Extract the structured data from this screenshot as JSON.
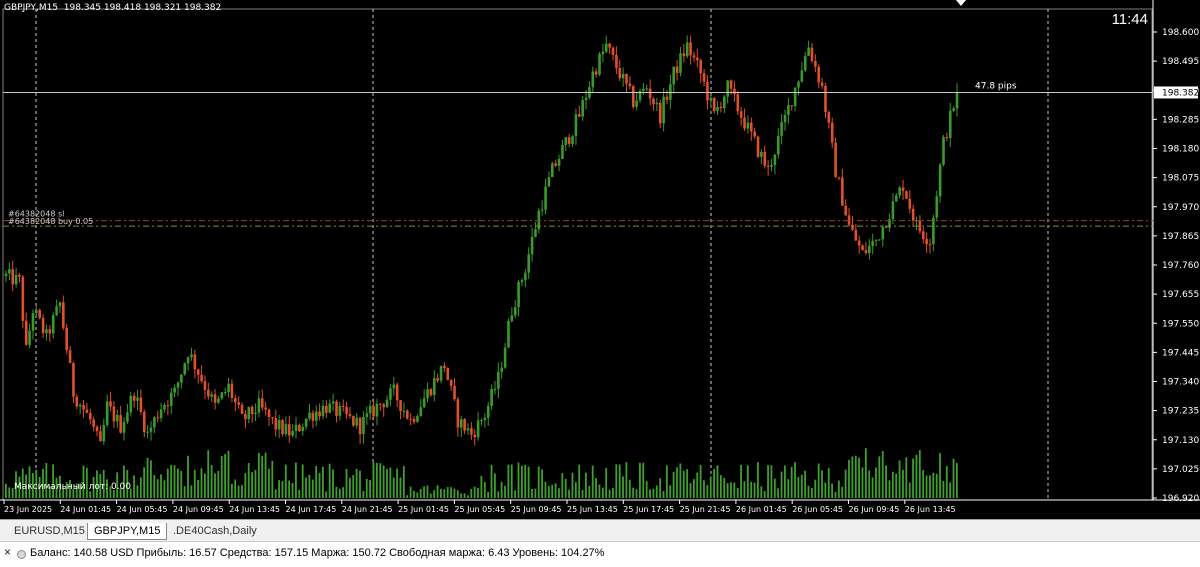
{
  "chart": {
    "title_symbol": "GBPJPY,M15",
    "title_ohlc": "198.345 198.418 198.321 198.382",
    "clock": "11:44",
    "current_price_label": "198.382",
    "pips_label": "47.8 pips",
    "order_label_1": "#64382048 sl",
    "order_label_2": "#64382048 buy 0.05",
    "max_lot_label": "Максимальный лот: 0.00",
    "price_axis": [
      "198.600",
      "198.495",
      "198.390",
      "198.285",
      "198.180",
      "198.075",
      "197.970",
      "197.865",
      "197.760",
      "197.655",
      "197.550",
      "197.445",
      "197.340",
      "197.235",
      "197.130",
      "197.025",
      "196.920"
    ],
    "time_axis": [
      "23 Jun 2025",
      "24 Jun 01:45",
      "24 Jun 05:45",
      "24 Jun 09:45",
      "24 Jun 13:45",
      "24 Jun 17:45",
      "24 Jun 21:45",
      "25 Jun 01:45",
      "25 Jun 05:45",
      "25 Jun 09:45",
      "25 Jun 13:45",
      "25 Jun 17:45",
      "25 Jun 21:45",
      "26 Jun 01:45",
      "26 Jun 05:45",
      "26 Jun 09:45",
      "26 Jun 13:45"
    ]
  },
  "colors": {
    "bull": "#3a9a2a",
    "bear": "#e0502a",
    "volume": "#3fa02e",
    "background": "#000000",
    "grid_separator": "#c8c8c8",
    "order_line": "#a04020",
    "order_line_2": "#6a9a3a"
  },
  "tabs": [
    {
      "label": "EURUSD,M15",
      "active": false
    },
    {
      "label": "GBPJPY,M15",
      "active": true
    },
    {
      "label": ".DE40Cash,Daily",
      "active": false
    }
  ],
  "status_bar": {
    "close_icon": "×",
    "text": "Баланс: 140.58 USD  Прибыль: 16.57  Средства: 157.15  Маржа: 150.72  Свободная маржа: 6.43  Уровень: 104.27%"
  },
  "chart_data": {
    "type": "candlestick",
    "symbol": "GBPJPY,M15",
    "ylim": [
      196.92,
      198.6
    ],
    "current_price": 198.382,
    "order_levels": [
      197.92,
      197.9
    ],
    "day_separators": [
      "24 Jun 01:45",
      "24 Jun 21:45",
      "25 Jun 21:45",
      "26 Jun 13:45"
    ],
    "price_path": [
      [
        0,
        197.72
      ],
      [
        4,
        197.7
      ],
      [
        6,
        197.45
      ],
      [
        8,
        197.6
      ],
      [
        12,
        197.5
      ],
      [
        16,
        197.62
      ],
      [
        20,
        197.3
      ],
      [
        25,
        197.2
      ],
      [
        28,
        197.1
      ],
      [
        30,
        197.25
      ],
      [
        34,
        197.18
      ],
      [
        38,
        197.3
      ],
      [
        42,
        197.15
      ],
      [
        46,
        197.25
      ],
      [
        50,
        197.3
      ],
      [
        54,
        197.45
      ],
      [
        58,
        197.35
      ],
      [
        62,
        197.25
      ],
      [
        66,
        197.32
      ],
      [
        70,
        197.2
      ],
      [
        75,
        197.25
      ],
      [
        80,
        197.18
      ],
      [
        85,
        197.15
      ],
      [
        90,
        197.22
      ],
      [
        95,
        197.25
      ],
      [
        100,
        197.22
      ],
      [
        105,
        197.18
      ],
      [
        110,
        197.25
      ],
      [
        115,
        197.3
      ],
      [
        120,
        197.2
      ],
      [
        125,
        197.3
      ],
      [
        130,
        197.4
      ],
      [
        134,
        197.2
      ],
      [
        138,
        197.15
      ],
      [
        142,
        197.22
      ],
      [
        146,
        197.35
      ],
      [
        150,
        197.6
      ],
      [
        154,
        197.75
      ],
      [
        158,
        197.95
      ],
      [
        162,
        198.1
      ],
      [
        166,
        198.2
      ],
      [
        170,
        198.3
      ],
      [
        174,
        198.45
      ],
      [
        178,
        198.55
      ],
      [
        182,
        198.45
      ],
      [
        186,
        198.35
      ],
      [
        190,
        198.4
      ],
      [
        194,
        198.3
      ],
      [
        198,
        198.45
      ],
      [
        202,
        198.55
      ],
      [
        206,
        198.45
      ],
      [
        210,
        198.3
      ],
      [
        214,
        198.4
      ],
      [
        218,
        198.3
      ],
      [
        222,
        198.2
      ],
      [
        226,
        198.1
      ],
      [
        230,
        198.25
      ],
      [
        234,
        198.4
      ],
      [
        238,
        198.55
      ],
      [
        242,
        198.4
      ],
      [
        246,
        198.1
      ],
      [
        250,
        197.9
      ],
      [
        254,
        197.8
      ],
      [
        258,
        197.85
      ],
      [
        262,
        197.95
      ],
      [
        266,
        198.05
      ],
      [
        270,
        197.9
      ],
      [
        274,
        197.85
      ],
      [
        278,
        198.2
      ],
      [
        282,
        198.38
      ]
    ]
  }
}
